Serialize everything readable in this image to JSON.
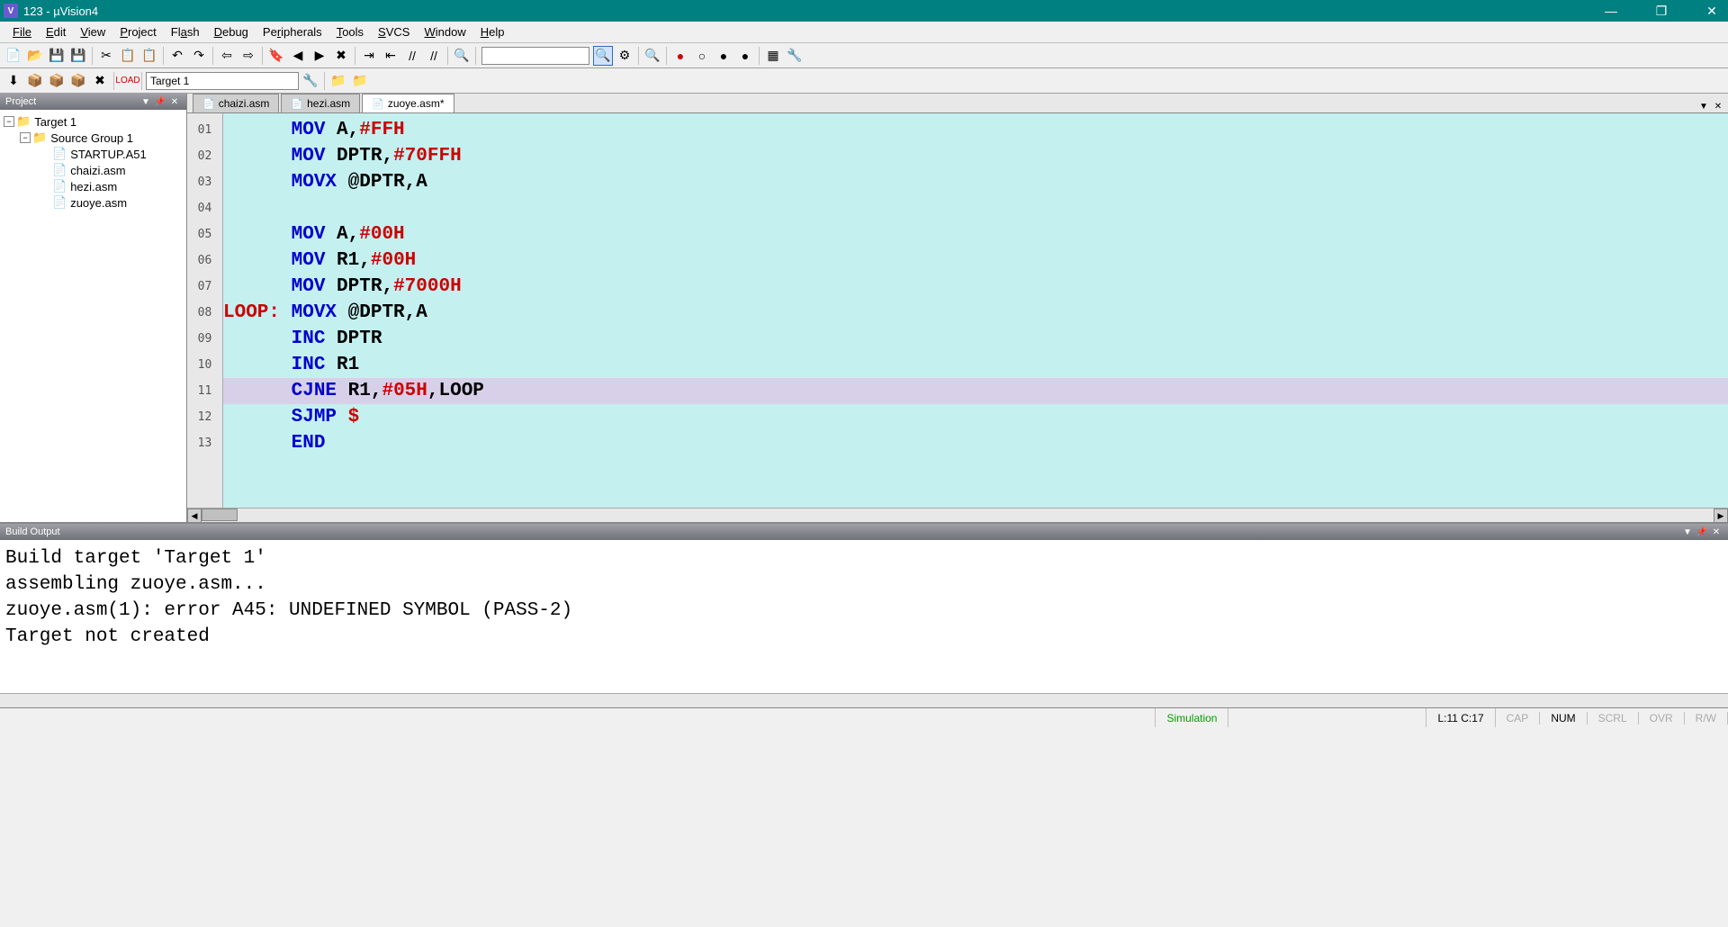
{
  "window": {
    "title": "123  - µVision4",
    "icon": "V"
  },
  "menus": [
    "File",
    "Edit",
    "View",
    "Project",
    "Flash",
    "Debug",
    "Peripherals",
    "Tools",
    "SVCS",
    "Window",
    "Help"
  ],
  "toolbar2": {
    "target": "Target 1"
  },
  "project": {
    "panel_title": "Project",
    "root": "Target 1",
    "group": "Source Group 1",
    "files": [
      "STARTUP.A51",
      "chaizi.asm",
      "hezi.asm",
      "zuoye.asm"
    ]
  },
  "tabs": {
    "items": [
      "chaizi.asm",
      "hezi.asm",
      "zuoye.asm*"
    ],
    "active": 2
  },
  "code": {
    "lines": [
      {
        "n": "01",
        "indent": "      ",
        "op": "MOV",
        "arg": " A,",
        "imm": "#FFH"
      },
      {
        "n": "02",
        "indent": "      ",
        "op": "MOV",
        "arg": " DPTR,",
        "imm": "#70FFH"
      },
      {
        "n": "03",
        "indent": "      ",
        "op": "MOVX",
        "arg": " @DPTR,A",
        "imm": ""
      },
      {
        "n": "04",
        "indent": "",
        "op": "",
        "arg": "",
        "imm": ""
      },
      {
        "n": "05",
        "indent": "      ",
        "op": "MOV",
        "arg": " A,",
        "imm": "#00H"
      },
      {
        "n": "06",
        "indent": "      ",
        "op": "MOV",
        "arg": " R1,",
        "imm": "#00H"
      },
      {
        "n": "07",
        "indent": "      ",
        "op": "MOV",
        "arg": " DPTR,",
        "imm": "#7000H"
      },
      {
        "n": "08",
        "lbl": "LOOP:",
        "indent": " ",
        "op": "MOVX",
        "arg": " @DPTR,A",
        "imm": ""
      },
      {
        "n": "09",
        "indent": "      ",
        "op": "INC",
        "arg": " DPTR",
        "imm": ""
      },
      {
        "n": "10",
        "indent": "      ",
        "op": "INC",
        "arg": " R1",
        "imm": ""
      },
      {
        "n": "11",
        "indent": "      ",
        "op": "CJNE",
        "arg": " R1,",
        "imm": "#05H",
        "tail": ",LOOP",
        "current": true
      },
      {
        "n": "12",
        "indent": "      ",
        "op": "SJMP",
        "arg": " ",
        "imm": "$"
      },
      {
        "n": "13",
        "indent": "      ",
        "op": "END",
        "arg": "",
        "imm": ""
      }
    ]
  },
  "build": {
    "panel_title": "Build Output",
    "lines": [
      "Build target 'Target 1'",
      "assembling zuoye.asm...",
      "zuoye.asm(1): error A45: UNDEFINED SYMBOL (PASS-2)",
      "Target not created"
    ]
  },
  "status": {
    "mode": "Simulation",
    "pos": "L:11 C:17",
    "cap": "CAP",
    "num": "NUM",
    "scrl": "SCRL",
    "ovr": "OVR",
    "rw": "R/W"
  }
}
